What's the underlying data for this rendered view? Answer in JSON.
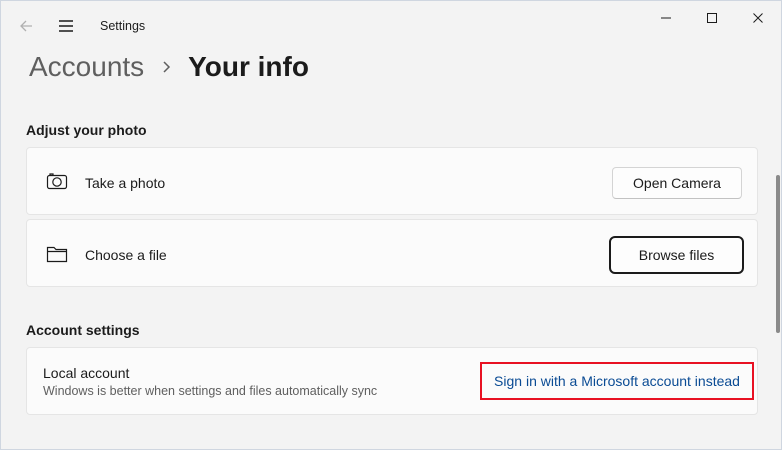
{
  "window": {
    "title": "Settings"
  },
  "breadcrumb": {
    "parent": "Accounts",
    "separator": "›",
    "current": "Your info"
  },
  "photo_section": {
    "header": "Adjust your photo",
    "take_photo": {
      "label": "Take a photo",
      "icon": "camera-icon",
      "button": "Open Camera"
    },
    "choose_file": {
      "label": "Choose a file",
      "icon": "folder-icon",
      "button": "Browse files"
    }
  },
  "account_section": {
    "header": "Account settings",
    "local_account": {
      "title": "Local account",
      "subtitle": "Windows is better when settings and files automatically sync",
      "link": "Sign in with a Microsoft account instead"
    }
  },
  "colors": {
    "background": "#f3f3f3",
    "card": "#fbfbfb",
    "link": "#0a4b94",
    "highlight": "#e81123"
  }
}
